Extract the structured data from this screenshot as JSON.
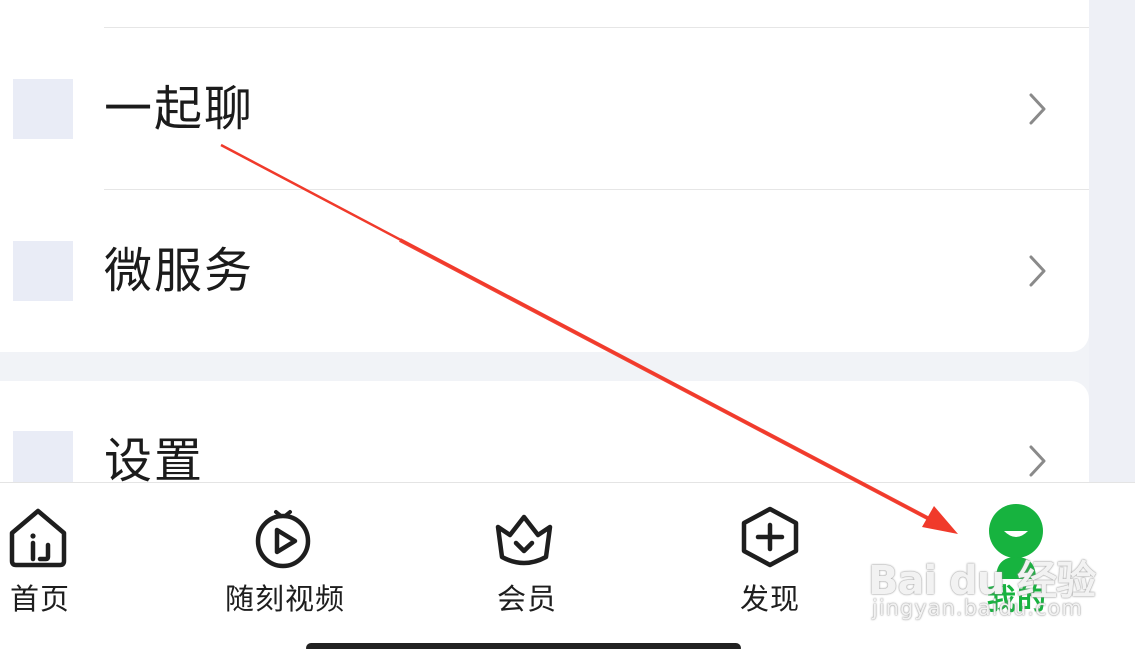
{
  "menu": {
    "items": [
      {
        "label": "一起聊",
        "icon": "chevron-right-icon"
      },
      {
        "label": "微服务",
        "icon": "chevron-right-icon"
      },
      {
        "label": "设置",
        "icon": "chevron-right-icon"
      }
    ]
  },
  "tabbar": {
    "tabs": [
      {
        "label": "首页",
        "icon": "home-icon",
        "active": false
      },
      {
        "label": "随刻视频",
        "icon": "play-circle-icon",
        "active": false
      },
      {
        "label": "会员",
        "icon": "crown-basket-icon",
        "active": false
      },
      {
        "label": "发现",
        "icon": "plus-hexagon-icon",
        "active": false
      },
      {
        "label": "我的",
        "icon": "smiley-avatar-icon",
        "active": true
      }
    ]
  },
  "watermark": {
    "brand": "Bai du 经验",
    "site": "jingyan.baidu.com"
  },
  "colors": {
    "accent_green": "#17b33f",
    "annotation_red": "#f03a2b",
    "background": "#f1f3f7"
  }
}
